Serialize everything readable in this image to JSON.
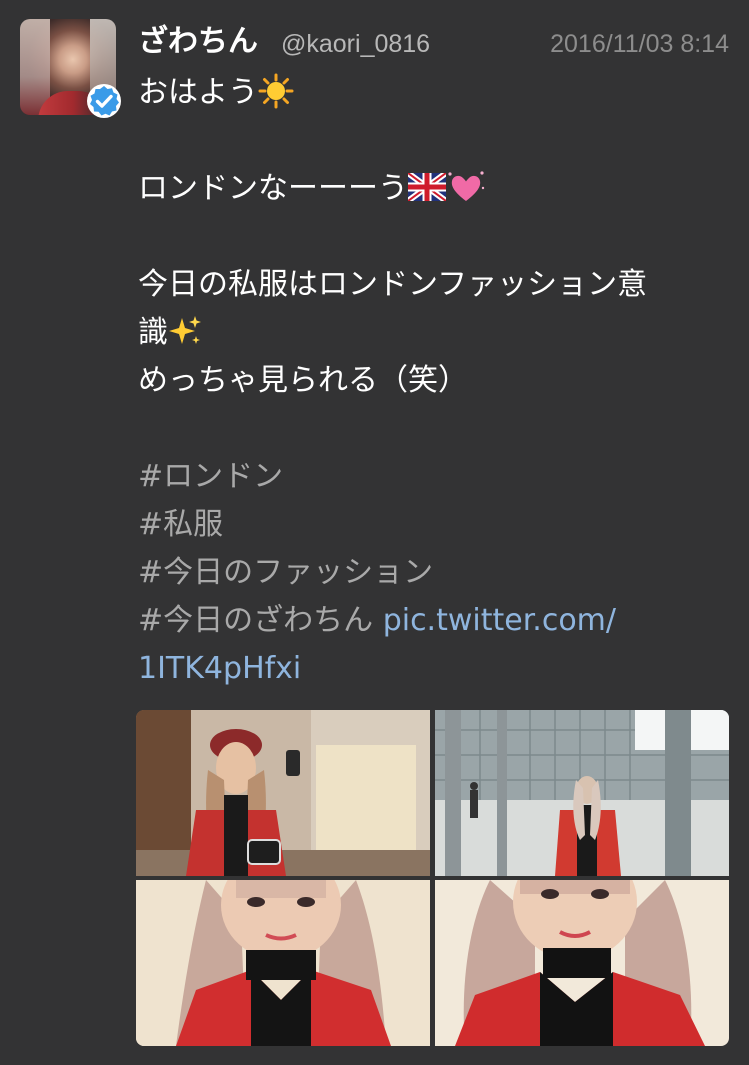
{
  "tweet": {
    "display_name": "ざわちん",
    "handle": "@kaori_0816",
    "timestamp": "2016/11/03 8:14",
    "verified": true,
    "lines": {
      "l1": "おはよう",
      "l3": "ロンドンなーーーう",
      "l5": "今日の私服はロンドンファッション意",
      "l6": "識",
      "l7": "めっちゃ見られる（笑）",
      "h1": "#ロンドン",
      "h2": "#私服",
      "h3": "#今日のファッション",
      "h4": "#今日のざわちん",
      "link_part1": "pic.twitter.com/",
      "link_part2": "1ITK4pHfxi"
    },
    "emojis": [
      "sun-emoji",
      "uk-flag-emoji",
      "sparkling-heart-emoji",
      "sparkles-emoji"
    ],
    "photos": [
      {
        "name": "photo-1-mirror-selfie"
      },
      {
        "name": "photo-2-building-exterior"
      },
      {
        "name": "photo-3-closeup"
      },
      {
        "name": "photo-4-closeup"
      }
    ]
  },
  "colors": {
    "background": "#333334",
    "text": "#ffffff",
    "handle": "#b8b8b8",
    "timestamp": "#8d8d8d",
    "hashtag": "#a9a9a9",
    "link": "#8fb5de",
    "verified": "#3a9be8"
  }
}
